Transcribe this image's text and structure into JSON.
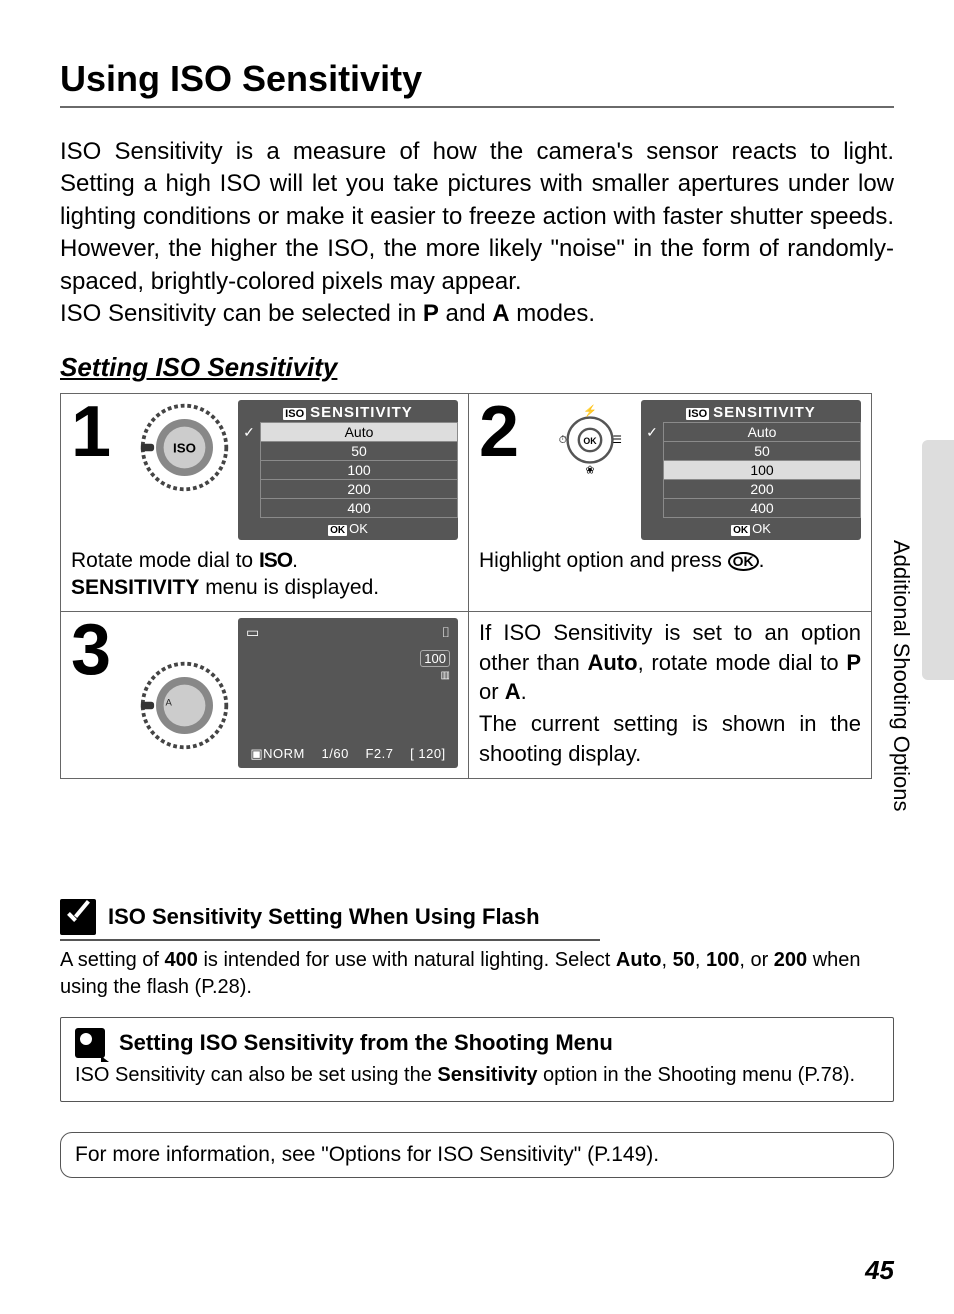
{
  "title": "Using ISO Sensitivity",
  "intro": "ISO Sensitivity is a measure of how the camera's sensor reacts to light. Setting a high ISO will let you take pictures with smaller apertures under low lighting conditions or make it easier to freeze action with faster shutter speeds. However, the higher the ISO, the more likely \"noise\" in the form of randomly-spaced, brightly-colored pixels may appear.",
  "intro2_a": "ISO Sensitivity can be selected in ",
  "intro2_b": " and ",
  "intro2_c": " modes.",
  "mode_p": "P",
  "mode_a": "A",
  "subheading": "Setting ISO Sensitivity",
  "lcd_title": "SENSITIVITY",
  "lcd_iso_tag": "ISO",
  "lcd_options": [
    "Auto",
    "50",
    "100",
    "200",
    "400"
  ],
  "lcd_ok": "OK",
  "step1_num": "1",
  "step1_cap_a": "Rotate mode dial to ",
  "step1_iso": "ISO",
  "step1_cap_b": ".",
  "step1_cap_c": "SENSITIVITY",
  "step1_cap_d": " menu is displayed.",
  "step2_num": "2",
  "step2_cap_a": "Highlight option and press ",
  "step2_cap_b": ".",
  "ok_btn": "OK",
  "step3_num": "3",
  "lcd3_shutter": "1/60",
  "lcd3_f": "F2.7",
  "lcd3_count": "[ 120]",
  "lcd3_icons_tl": "▭",
  "lcd3_icons_tr": "⌷",
  "lcd3_icons_r": "100",
  "lcd3_icons_bl": "NORM",
  "cell4_a": "If ISO Sensitivity is set to an option other than ",
  "cell4_auto": "Auto",
  "cell4_b": ", rotate mode dial to ",
  "cell4_or": " or ",
  "cell4_c": ".",
  "cell4_d": "The current setting is shown in the shooting display.",
  "side_label": "Additional Shooting Options",
  "note1_title": "ISO Sensitivity Setting When Using Flash",
  "note1_a": "A setting of ",
  "note1_400": "400",
  "note1_b": " is intended for use with natural lighting. Select ",
  "note1_auto": "Auto",
  "note1_c": ", ",
  "note1_50": "50",
  "note1_100": "100",
  "note1_d": ", or ",
  "note1_200": "200",
  "note1_e": " when using the flash (P.28).",
  "note2_title": "Setting ISO Sensitivity from the Shooting Menu",
  "note2_a": "ISO Sensitivity can also be set using the ",
  "note2_sens": "Sensitivity",
  "note2_b": " option in the Shooting menu (P.78).",
  "note3": "For more information, see \"Options for ISO Sensitivity\" (P.149).",
  "page_num": "45"
}
